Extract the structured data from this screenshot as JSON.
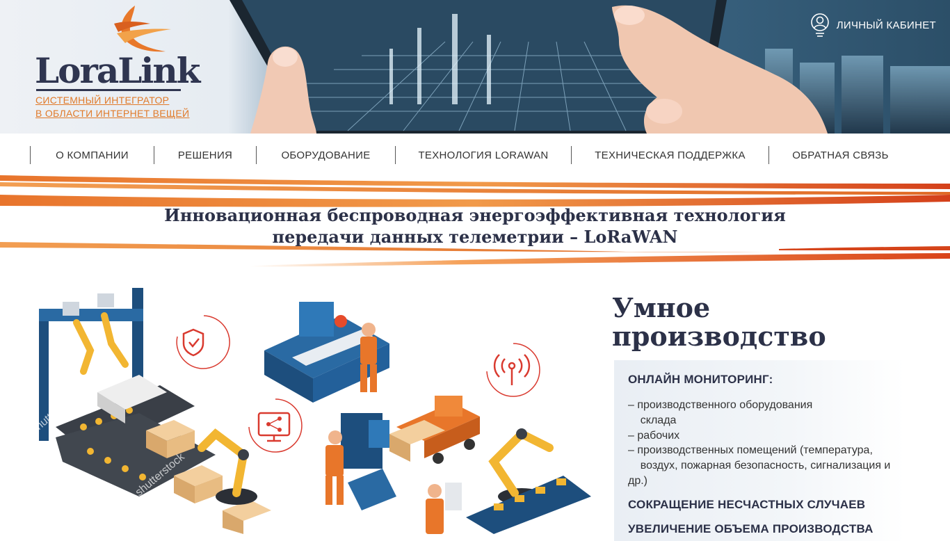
{
  "header": {
    "logo_text": "LoraLink",
    "tagline_line1": "СИСТЕМНЫЙ ИНТЕГРАТОР ",
    "tagline_line2": "В ОБЛАСТИ ИНТЕРНЕТ ВЕЩЕЙ ",
    "account_label": "ЛИЧНЫЙ КАБИНЕТ"
  },
  "nav": {
    "items": [
      {
        "label": "О КОМПАНИИ"
      },
      {
        "label": "РЕШЕНИЯ"
      },
      {
        "label": "ОБОРУДОВАНИЕ"
      },
      {
        "label": "ТЕХНОЛОГИЯ LORAWAN"
      },
      {
        "label": "ТЕХНИЧЕСКАЯ ПОДДЕРЖКА"
      },
      {
        "label": "ОБРАТНАЯ СВЯЗЬ"
      }
    ]
  },
  "banner": {
    "headline_line1": "Инновационная беспроводная энергоэффективная технология",
    "headline_line2": "передачи данных телеметрии – LoRaWAN"
  },
  "illustration": {
    "watermark": "shutterstock",
    "icons": [
      "shield-check-icon",
      "share-screen-icon",
      "wireless-antenna-icon"
    ]
  },
  "section": {
    "title_line1": "Умное",
    "title_line2": "производство",
    "heading1": "ОНЛАЙН МОНИТОРИНГ:",
    "list": [
      "– производственного оборудования",
      "    склада",
      "– рабочих",
      "– производственных помещений (температура,",
      "    воздух, пожарная безопасность, сигнализация и",
      "др.)"
    ],
    "heading2": "СОКРАЩЕНИЕ НЕСЧАСТНЫХ СЛУЧАЕВ",
    "heading3": "УВЕЛИЧЕНИЕ ОБЪЕМА ПРОИЗВОДСТВА"
  },
  "colors": {
    "brand_orange": "#e07a2a",
    "brand_dark": "#2f3550",
    "stripe_red": "#d5441a"
  }
}
